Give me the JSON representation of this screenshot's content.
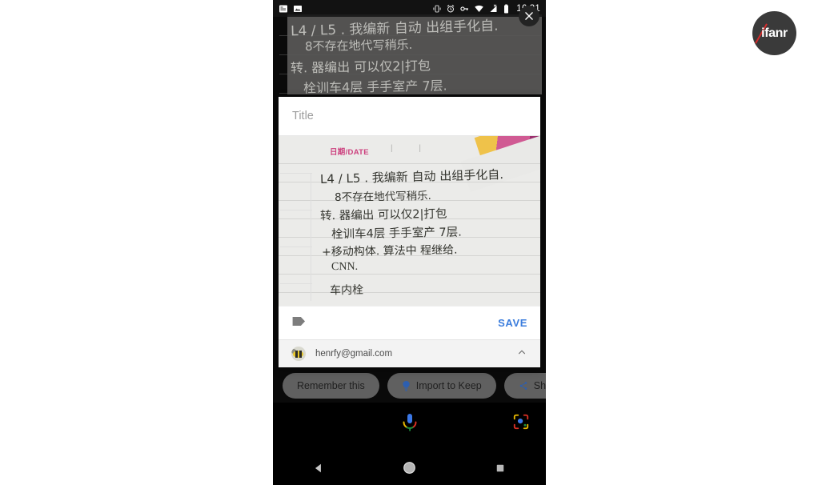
{
  "watermark": {
    "text": "ifanr",
    "name": "ifanr-logo"
  },
  "status_bar": {
    "time": "16:31",
    "left_icons": [
      {
        "name": "notification-list-icon",
        "label": "notifications"
      },
      {
        "name": "screenshot-image-icon",
        "label": "screenshot"
      }
    ],
    "right_icons": [
      {
        "name": "vibrate-icon",
        "label": "vibrate"
      },
      {
        "name": "alarm-clock-icon",
        "label": "alarm"
      },
      {
        "name": "vpn-key-icon",
        "label": "vpn"
      },
      {
        "name": "wifi-icon",
        "label": "wifi"
      },
      {
        "name": "mobile-signal-off-icon",
        "label": "no signal"
      },
      {
        "name": "battery-icon",
        "label": "battery"
      }
    ]
  },
  "close_button": {
    "name": "close-icon",
    "label": "Close"
  },
  "keep_dialog": {
    "title_placeholder": "Title",
    "save_label": "SAVE",
    "label_icon_name": "label-tag-icon",
    "account": {
      "email": "henrfy@gmail.com",
      "expand_icon_name": "chevron-up-icon"
    },
    "note_image": {
      "date_header": "日期/DATE",
      "date_marks": "| |",
      "handwriting_lines": [
        "L4 / L5 . 我编新  自动 出组手化自.",
        "8不存在地代写稍乐.",
        "转. 器编出 可以仅2|打包",
        "栓训车4层   手手室产 7层.",
        "+移动构体. 算法中 程继给.",
        "CNN.",
        "车内栓"
      ]
    }
  },
  "chips": [
    {
      "label": "Remember this",
      "icon": "none",
      "name": "chip-remember-this"
    },
    {
      "label": "Import to Keep",
      "icon": "keep-bulb-icon",
      "name": "chip-import-to-keep"
    },
    {
      "label": "Share",
      "icon": "share-icon",
      "name": "chip-share"
    }
  ],
  "assistant_bar": {
    "mic_icon_name": "google-assistant-mic-icon",
    "lens_icon_name": "google-lens-icon"
  },
  "nav_bar": {
    "back_icon_name": "back-triangle-icon",
    "home_icon_name": "home-circle-icon",
    "recents_icon_name": "recents-square-icon"
  },
  "colors": {
    "save_blue": "#3b7ddd",
    "keep_bulb_blue": "#2d5fb0",
    "date_pink": "#cc3f7d",
    "card_white": "#ffffff",
    "chip_gray": "#969696"
  }
}
